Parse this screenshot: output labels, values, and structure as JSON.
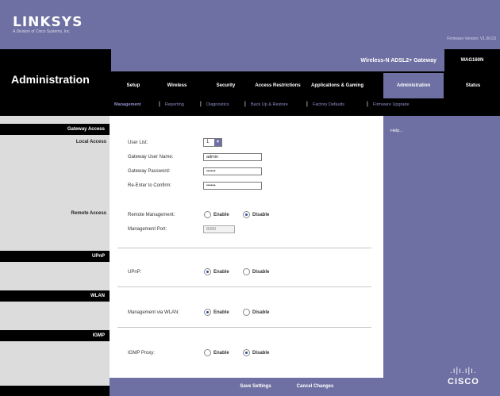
{
  "brand": {
    "logo": "LINKSYS",
    "logo_sub": "A Division of Cisco Systems, Inc.",
    "firmware": "Firmware Version: V1.00.03"
  },
  "page": {
    "title": "Administration",
    "model_name": "Wireless-N ADSL2+ Gateway",
    "model_number": "WAG160N"
  },
  "nav": {
    "items": [
      {
        "label": "Setup"
      },
      {
        "label": "Wireless"
      },
      {
        "label": "Security"
      },
      {
        "label": "Access Restrictions"
      },
      {
        "label": "Applications & Gaming"
      },
      {
        "label": "Administration",
        "active": true
      },
      {
        "label": "Status"
      }
    ]
  },
  "subtabs": [
    {
      "label": "Management",
      "active": true
    },
    {
      "label": "Reporting"
    },
    {
      "label": "Diagnostics"
    },
    {
      "label": "Back Up & Restore"
    },
    {
      "label": "Factory Defaults"
    },
    {
      "label": "Firmware Upgrade"
    }
  ],
  "sections": {
    "gateway_access": "Gateway Access",
    "local_access": "Local Access",
    "remote_access": "Remote Access",
    "upnp": "UPnP",
    "wlan": "WLAN",
    "igmp": "IGMP"
  },
  "form": {
    "user_list_label": "User List:",
    "user_list_value": "1",
    "user_name_label": "Gateway User Name:",
    "user_name_value": "admin",
    "password_label": "Gateway Password:",
    "password_value": "••••••",
    "reenter_label": "Re-Enter to Confirm:",
    "reenter_value": "••••••",
    "remote_mgmt_label": "Remote Management:",
    "mgmt_port_label": "Management Port:",
    "mgmt_port_value": "8080",
    "upnp_label": "UPnP:",
    "wlan_label": "Management via WLAN:",
    "igmp_label": "IGMP Proxy:",
    "enable": "Enable",
    "disable": "Disable"
  },
  "radios": {
    "remote": "disable",
    "upnp": "enable",
    "wlan": "enable",
    "igmp": "disable"
  },
  "help": "Help...",
  "buttons": {
    "save": "Save Settings",
    "cancel": "Cancel Changes"
  },
  "cisco": {
    "bars": ".ı|ı.ı|ı.",
    "word": "CISCO"
  }
}
